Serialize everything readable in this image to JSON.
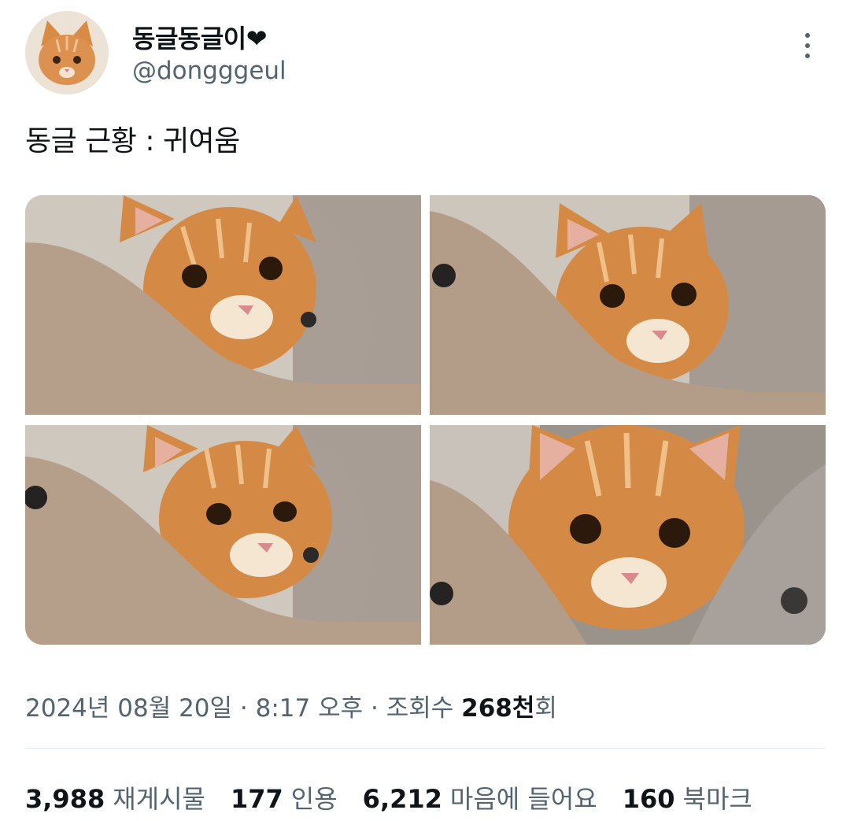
{
  "author": {
    "display_name": "동글동글이❤",
    "handle": "@dongggeul",
    "avatar_icon": "orange-cat-avatar"
  },
  "tweet": {
    "text": "동글 근황 : 귀여움",
    "photos": [
      {
        "alt": "orange-tabby-cat-in-felt-bed-1"
      },
      {
        "alt": "orange-tabby-cat-in-felt-bed-2"
      },
      {
        "alt": "orange-tabby-cat-in-felt-bed-3"
      },
      {
        "alt": "orange-tabby-cat-in-felt-bed-4"
      }
    ]
  },
  "meta": {
    "date": "2024년 08월 20일",
    "sep1": "·",
    "time": "8:17 오후",
    "sep2": "·",
    "views_label": "조회수",
    "views_count": "268천",
    "views_suffix": "회"
  },
  "stats": {
    "retweets": {
      "count": "3,988",
      "label": "재게시물"
    },
    "quotes": {
      "count": "177",
      "label": "인용"
    },
    "likes": {
      "count": "6,212",
      "label": "마음에 들어요"
    },
    "bookmarks": {
      "count": "160",
      "label": "북마크"
    }
  },
  "colors": {
    "text_primary": "#0f1419",
    "text_secondary": "#536471",
    "divider": "#e1e6ea",
    "cat_orange": "#d98a45",
    "felt": "#b8a592"
  }
}
